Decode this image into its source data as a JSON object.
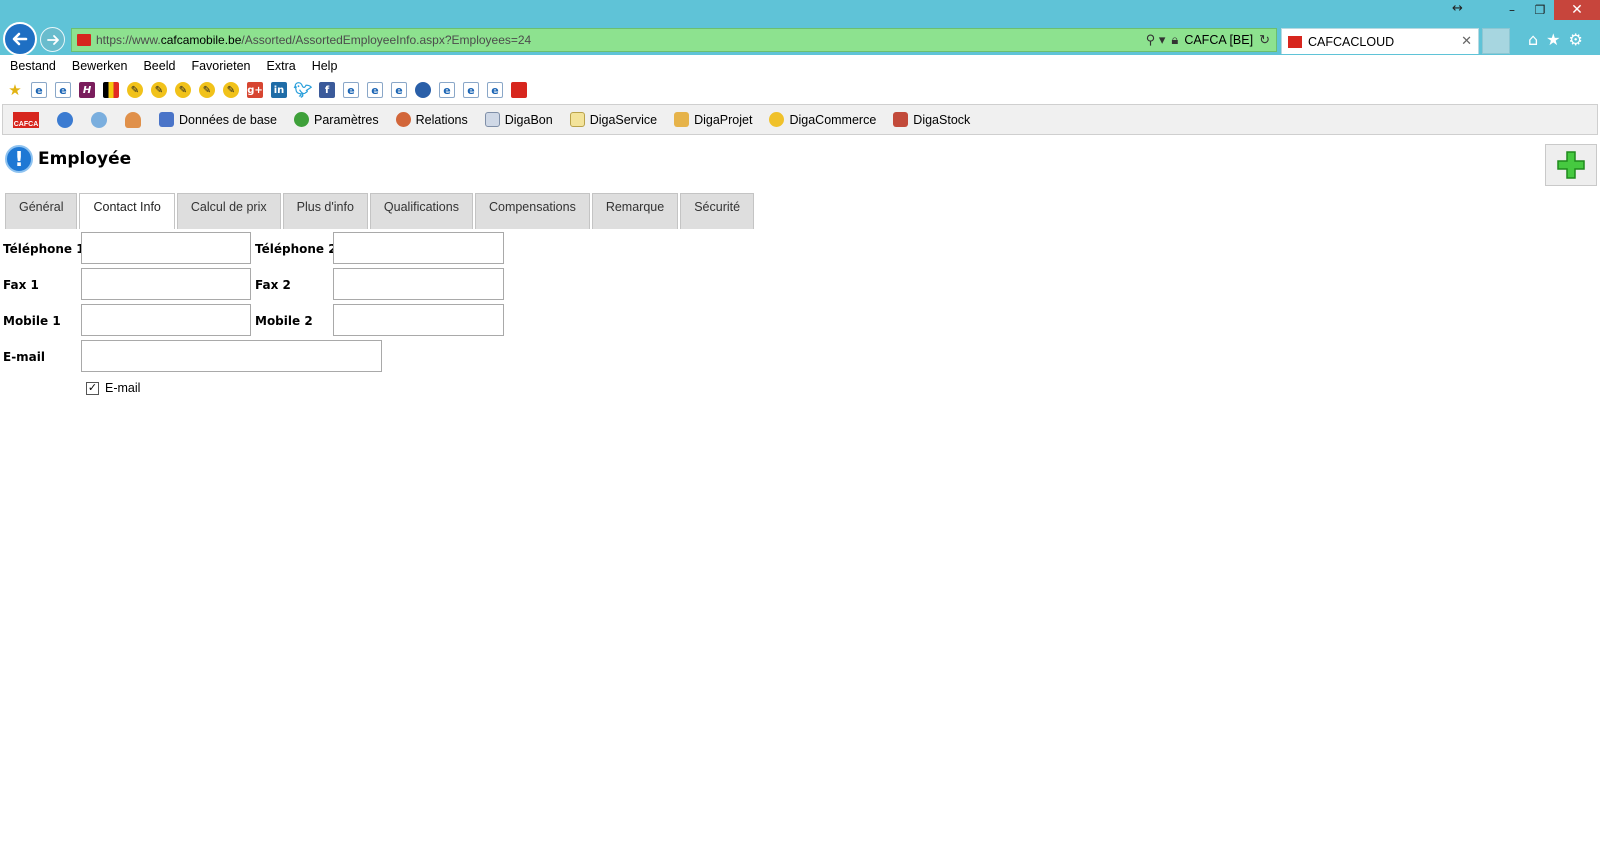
{
  "browser": {
    "url_scheme": "https://www.",
    "url_domain": "cafcamobile.be",
    "url_path": "/Assorted/AssortedEmployeeInfo.aspx?Employees=24",
    "security_label": "CAFCA [BE]",
    "tab_title": "CAFCACLOUD"
  },
  "menu": [
    "Bestand",
    "Bewerken",
    "Beeld",
    "Favorieten",
    "Extra",
    "Help"
  ],
  "toolbar": {
    "logo": "CAFCA",
    "items": [
      "Données de base",
      "Paramètres",
      "Relations",
      "DigaBon",
      "DigaService",
      "DigaProjet",
      "DigaCommerce",
      "DigaStock"
    ]
  },
  "page": {
    "title": "Employée",
    "tabs": [
      "Général",
      "Contact Info",
      "Calcul de prix",
      "Plus d'info",
      "Qualifications",
      "Compensations",
      "Remarque",
      "Sécurité"
    ],
    "active_tab": "Contact Info"
  },
  "form": {
    "telephone1_label": "Téléphone 1",
    "telephone1_value": "",
    "telephone2_label": "Téléphone 2",
    "telephone2_value": "",
    "fax1_label": "Fax 1",
    "fax1_value": "",
    "fax2_label": "Fax 2",
    "fax2_value": "",
    "mobile1_label": "Mobile 1",
    "mobile1_value": "",
    "mobile2_label": "Mobile 2",
    "mobile2_value": "",
    "email_label": "E-mail",
    "email_value": "",
    "email_checkbox_label": "E-mail",
    "email_checkbox_checked": true
  },
  "colors": {
    "chrome": "#5fc3d7",
    "address_bar": "#8de28f",
    "back_button": "#1e6fc3",
    "cafca_red": "#d7261e",
    "add_green": "#3cc23c"
  }
}
